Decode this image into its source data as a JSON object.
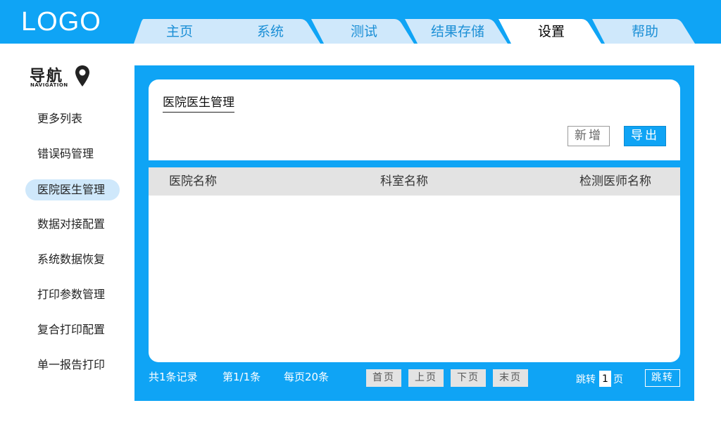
{
  "app": {
    "logo": "LOGO"
  },
  "tabs": [
    {
      "label": "主页"
    },
    {
      "label": "系统"
    },
    {
      "label": "测试"
    },
    {
      "label": "结果存储"
    },
    {
      "label": "设置",
      "active": true
    },
    {
      "label": "帮助"
    }
  ],
  "sidebar": {
    "title": "导航",
    "subtitle": "NAVIGATION",
    "items": [
      {
        "label": "更多列表"
      },
      {
        "label": "错误码管理"
      },
      {
        "label": "医院医生管理",
        "active": true
      },
      {
        "label": "数据对接配置"
      },
      {
        "label": "系统数据恢复"
      },
      {
        "label": "打印参数管理"
      },
      {
        "label": "复合打印配置"
      },
      {
        "label": "单一报告打印"
      }
    ]
  },
  "main": {
    "page_title": "医院医生管理",
    "add_label": "新增",
    "export_label": "导出",
    "columns": [
      "医院名称",
      "科室名称",
      "检测医师名称"
    ],
    "rows": []
  },
  "pagination": {
    "total": "共1条记录",
    "page": "第1/1条",
    "per_page": "每页20条",
    "first": "首页",
    "prev": "上页",
    "next": "下页",
    "last": "末页",
    "jump_prefix": "跳转",
    "jump_value": "1",
    "jump_suffix": "页",
    "jump_button": "跳转"
  },
  "colors": {
    "accent": "#0fa4f5",
    "active_bg": "#cfe8fb"
  }
}
